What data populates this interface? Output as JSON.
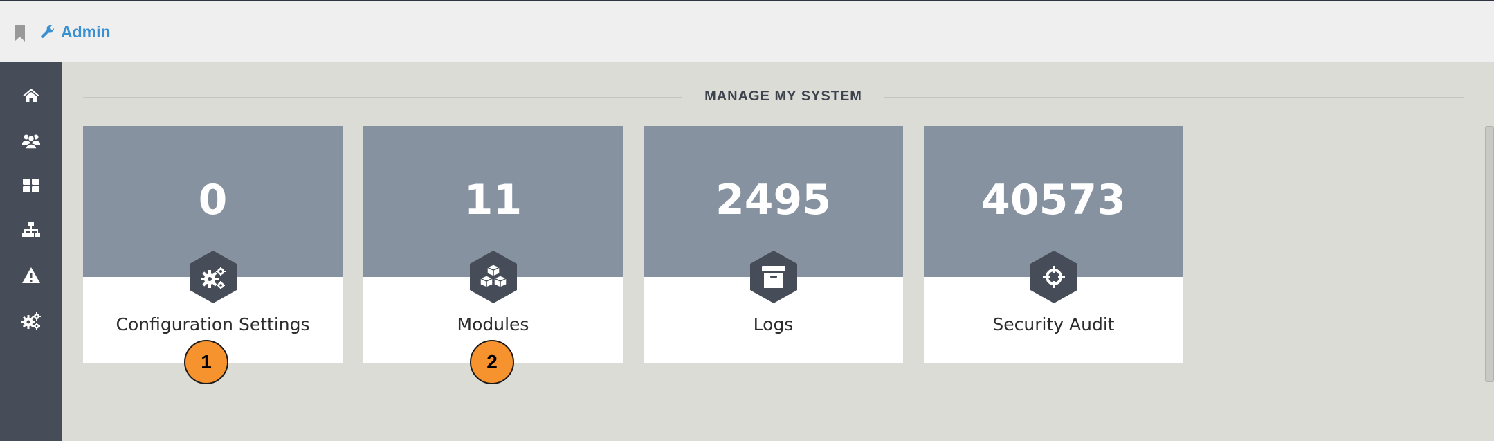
{
  "breadcrumb": {
    "label": "Admin"
  },
  "sidebar": {
    "items": [
      {
        "icon": "home-icon"
      },
      {
        "icon": "users-icon"
      },
      {
        "icon": "grid-icon"
      },
      {
        "icon": "sitemap-icon"
      },
      {
        "icon": "warning-icon"
      },
      {
        "icon": "gears-icon"
      }
    ]
  },
  "section": {
    "title": "MANAGE MY SYSTEM"
  },
  "cards": [
    {
      "count": "0",
      "label": "Configuration Settings",
      "icon": "gears-icon"
    },
    {
      "count": "11",
      "label": "Modules",
      "icon": "cubes-icon"
    },
    {
      "count": "2495",
      "label": "Logs",
      "icon": "archive-icon"
    },
    {
      "count": "40573",
      "label": "Security Audit",
      "icon": "crosshairs-icon"
    }
  ],
  "annotations": [
    {
      "label": "1"
    },
    {
      "label": "2"
    }
  ],
  "colors": {
    "accent": "#3a8fd1",
    "sidebar": "#464d58",
    "card_top": "#8792a0",
    "hex": "#464d58",
    "badge": "#f7932e"
  }
}
